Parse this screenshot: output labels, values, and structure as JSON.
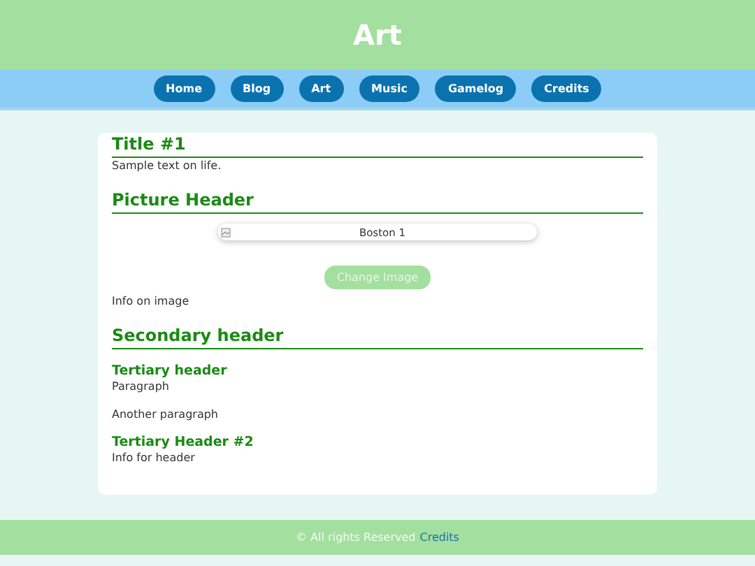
{
  "site_title": "Art",
  "nav": [
    {
      "label": "Home"
    },
    {
      "label": "Blog"
    },
    {
      "label": "Art"
    },
    {
      "label": "Music"
    },
    {
      "label": "Gamelog"
    },
    {
      "label": "Credits"
    }
  ],
  "content": [
    {
      "kind": "h2",
      "text": "Title #1"
    },
    {
      "kind": "p",
      "text": "Sample text on life."
    },
    {
      "kind": "h2",
      "text": "Picture Header"
    },
    {
      "kind": "image",
      "alt": "Boston 1"
    },
    {
      "kind": "button",
      "text": "Change Image"
    },
    {
      "kind": "p",
      "text": "Info on image"
    },
    {
      "kind": "h2",
      "text": "Secondary header"
    },
    {
      "kind": "h3",
      "text": "Tertiary header"
    },
    {
      "kind": "p",
      "text": "Paragraph"
    },
    {
      "kind": "p",
      "text": "Another paragraph"
    },
    {
      "kind": "h3",
      "text": "Tertiary Header #2"
    },
    {
      "kind": "p",
      "text": "Info for header"
    }
  ],
  "footer": {
    "text": "© All rights Reserved",
    "link": "Credits"
  }
}
